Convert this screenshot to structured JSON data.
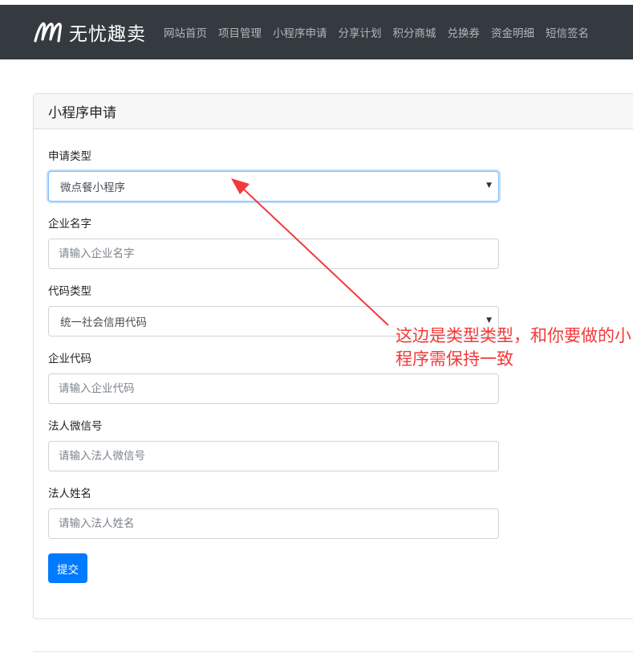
{
  "header": {
    "brand_name": "无忧趣卖",
    "nav": [
      "网站首页",
      "项目管理",
      "小程序申请",
      "分享计划",
      "积分商城",
      "兑换券",
      "资金明细",
      "短信签名"
    ]
  },
  "card": {
    "title": "小程序申请",
    "fields": {
      "apply_type": {
        "label": "申请类型",
        "value": "微点餐小程序"
      },
      "company_name": {
        "label": "企业名字",
        "placeholder": "请输入企业名字"
      },
      "code_type": {
        "label": "代码类型",
        "value": "统一社会信用代码"
      },
      "company_code": {
        "label": "企业代码",
        "placeholder": "请输入企业代码"
      },
      "legal_wechat": {
        "label": "法人微信号",
        "placeholder": "请输入法人微信号"
      },
      "legal_name": {
        "label": "法人姓名",
        "placeholder": "请输入法人姓名"
      }
    },
    "submit_label": "提交"
  },
  "annotation": {
    "text": "这边是类型类型，和你要做的小程序需保持一致",
    "color": "#f33a3a"
  },
  "colors": {
    "navbar_bg": "#343a40",
    "primary": "#007bff"
  },
  "icons": {
    "brand": "brand-logo-icon",
    "select_caret": "caret-down-icon",
    "annotation_arrow": "arrow-icon"
  }
}
